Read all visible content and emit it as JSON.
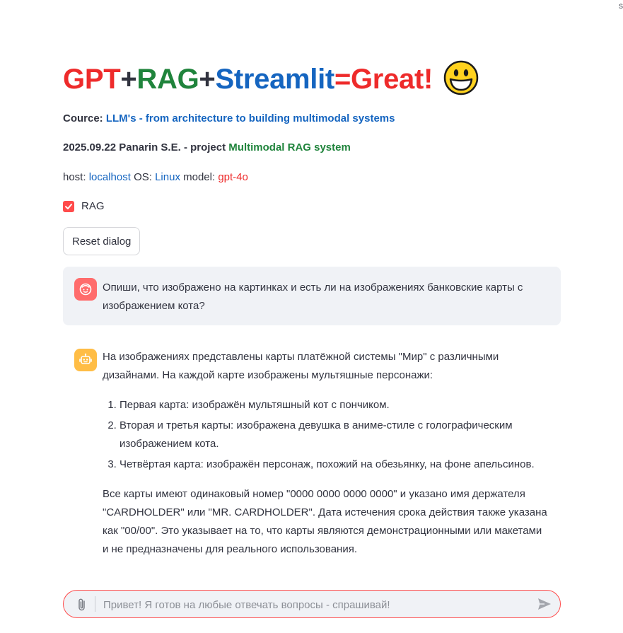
{
  "corner_mark": "S",
  "title": {
    "part1": "GPT",
    "plus1": "+",
    "part2": "RAG",
    "plus2": "+",
    "part3": "Streamlit",
    "part4": "=Great!",
    "emoji_icon": "grinning-face-icon"
  },
  "course": {
    "label": "Cource:",
    "link_text": "LLM's - from architecture to building multimodal systems"
  },
  "project": {
    "text": "2025.09.22 Panarin S.E. - project",
    "link_text": "Multimodal RAG system"
  },
  "host_info": {
    "host_label": "host:",
    "host_value": "localhost",
    "os_label": "OS:",
    "os_value": "Linux",
    "model_label": "model:",
    "model_value": "gpt-4o"
  },
  "rag_checkbox": {
    "label": "RAG",
    "checked": true
  },
  "reset_button": {
    "label": "Reset dialog"
  },
  "messages": [
    {
      "role": "user",
      "avatar_icon": "user-face-icon",
      "text": "Опиши, что изображено на картинках и есть ли на изображениях банковские карты с изображением кота?"
    },
    {
      "role": "assistant",
      "avatar_icon": "robot-icon",
      "intro": "На изображениях представлены карты платёжной системы \"Мир\" с различными дизайнами. На каждой карте изображены мультяшные персонажи:",
      "list": [
        "Первая карта: изображён мультяшный кот с пончиком.",
        "Вторая и третья карты: изображена девушка в аниме-стиле с голографическим изображением кота.",
        "Четвёртая карта: изображён персонаж, похожий на обезьянку, на фоне апельсинов."
      ],
      "outro": "Все карты имеют одинаковый номер \"0000 0000 0000 0000\" и указано имя держателя \"CARDHOLDER\" или \"MR. CARDHOLDER\". Дата истечения срока действия также указана как \"00/00\". Это указывает на то, что карты являются демонстрационными или макетами и не предназначены для реального использования."
    }
  ],
  "chat_input": {
    "placeholder": "Привет! Я готов на любые отвечать вопросы - спрашивай!",
    "value": "",
    "attach_icon": "paperclip-icon",
    "send_icon": "send-icon"
  },
  "colors": {
    "accent": "#ff4b4b",
    "title_red": "#ee2b2b",
    "title_green": "#20843c",
    "title_blue": "#1565c0",
    "user_avatar": "#ff6c6c",
    "bot_avatar": "#ffbd45",
    "message_bg": "#f0f2f6"
  }
}
